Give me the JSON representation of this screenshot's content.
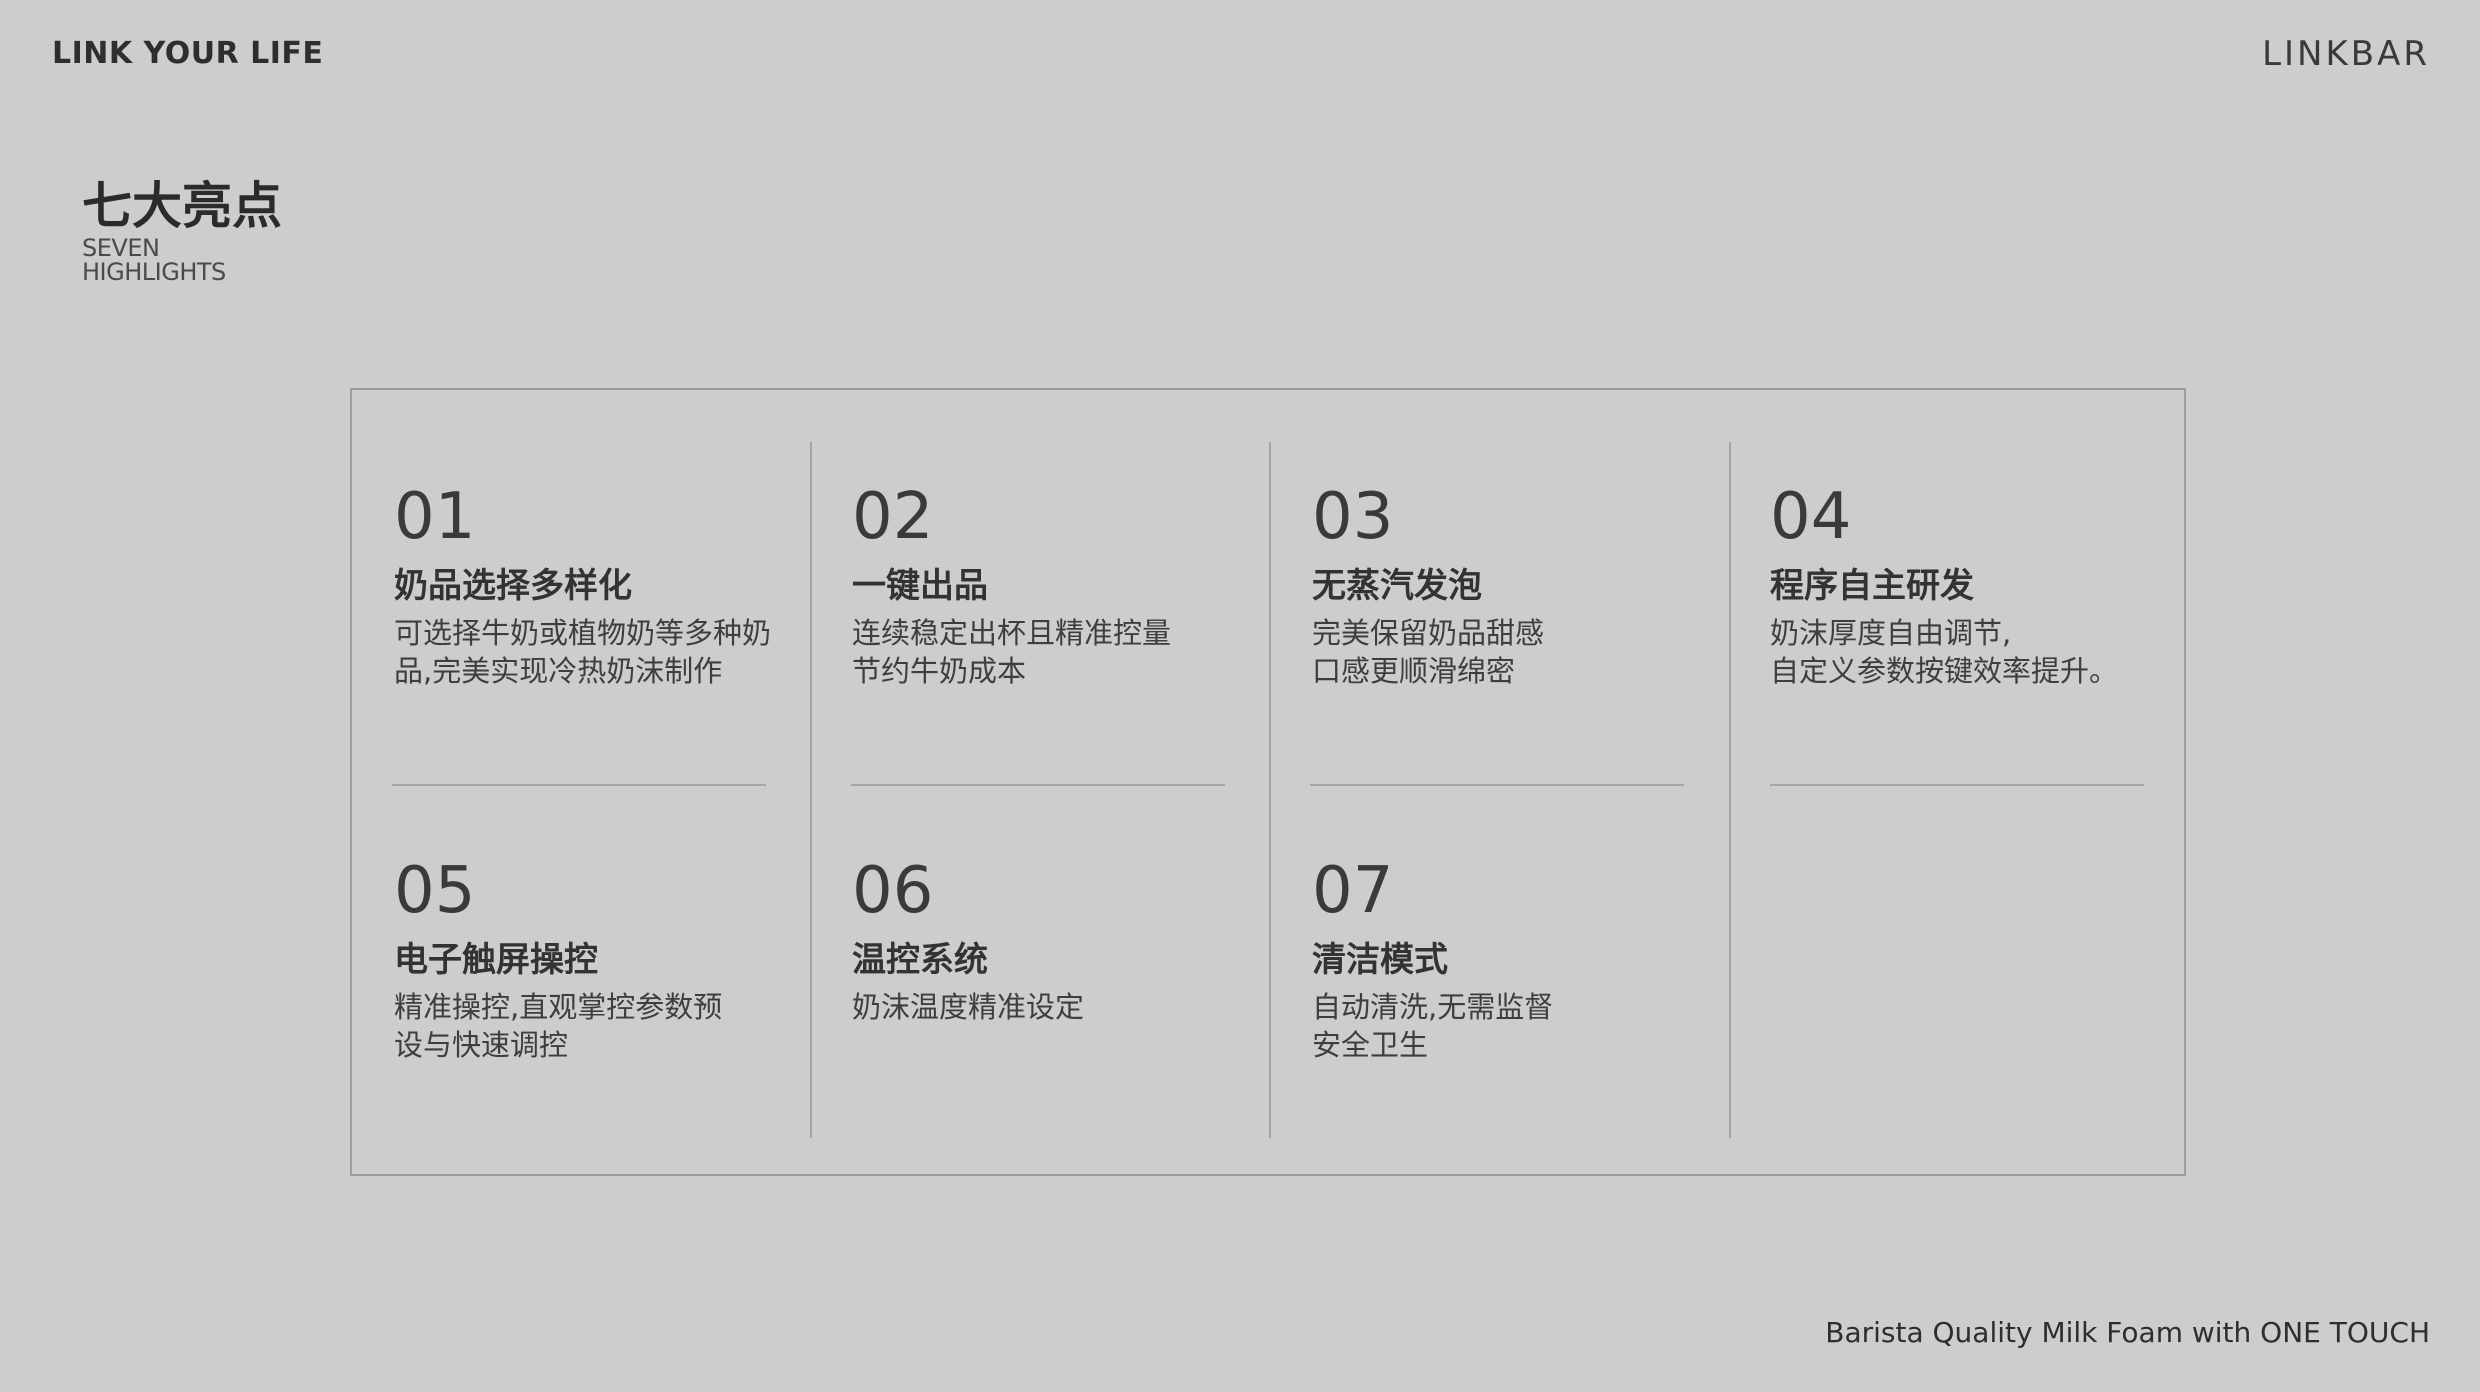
{
  "header": {
    "tagline": "LINK YOUR LIFE",
    "logo": "LINKBAR"
  },
  "section": {
    "title_cn": "七大亮点",
    "title_en_line1": "SEVEN",
    "title_en_line2": "HIGHLIGHTS"
  },
  "highlights": [
    {
      "number": "01",
      "title": "奶品选择多样化",
      "desc": "可选择牛奶或植物奶等多种奶\n品,完美实现冷热奶沫制作"
    },
    {
      "number": "02",
      "title": "一键出品",
      "desc": "连续稳定出杯且精准控量\n节约牛奶成本"
    },
    {
      "number": "03",
      "title": "无蒸汽发泡",
      "desc": "完美保留奶品甜感\n口感更顺滑绵密"
    },
    {
      "number": "04",
      "title": "程序自主研发",
      "desc": "奶沫厚度自由调节,\n自定义参数按键效率提升。"
    },
    {
      "number": "05",
      "title": "电子触屏操控",
      "desc": "精准操控,直观掌控参数预\n设与快速调控"
    },
    {
      "number": "06",
      "title": "温控系统",
      "desc": "奶沫温度精准设定"
    },
    {
      "number": "07",
      "title": "清洁模式",
      "desc": "自动清洗,无需监督\n安全卫生"
    }
  ],
  "footer": {
    "slogan": "Barista Quality Milk Foam with ONE TOUCH"
  },
  "colors": {
    "background": "#cdcdcd",
    "text": "#3a3a3a",
    "divider": "#a5a5a5"
  }
}
